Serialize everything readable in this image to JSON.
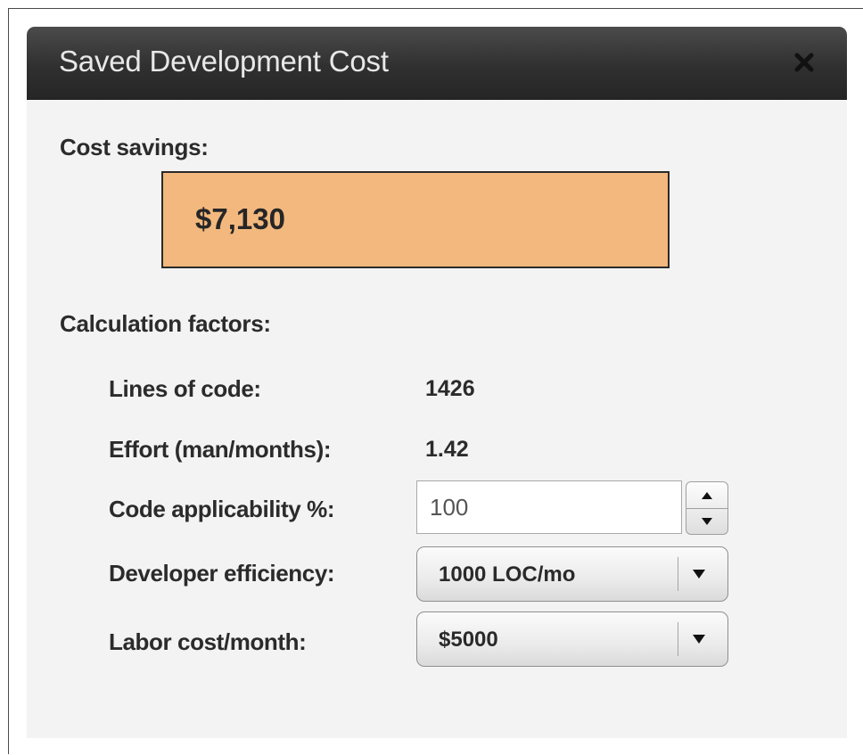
{
  "dialog": {
    "title": "Saved Development Cost",
    "close_icon": "close-icon"
  },
  "savings": {
    "label": "Cost savings:",
    "value": "$7,130",
    "box_color": "#f3b87e"
  },
  "factors": {
    "label": "Calculation factors:",
    "lines_of_code": {
      "label": "Lines of code:",
      "value": "1426"
    },
    "effort": {
      "label": "Effort (man/months):",
      "value": "1.42"
    },
    "code_applicability": {
      "label": "Code applicability %:",
      "value": "100",
      "up_icon": "arrow-up-icon",
      "down_icon": "arrow-down-icon"
    },
    "developer_efficiency": {
      "label": "Developer efficiency:",
      "selected": "1000 LOC/mo",
      "icon": "dropdown-arrow-icon"
    },
    "labor_cost": {
      "label": "Labor cost/month:",
      "selected": "$5000",
      "icon": "dropdown-arrow-icon"
    }
  }
}
